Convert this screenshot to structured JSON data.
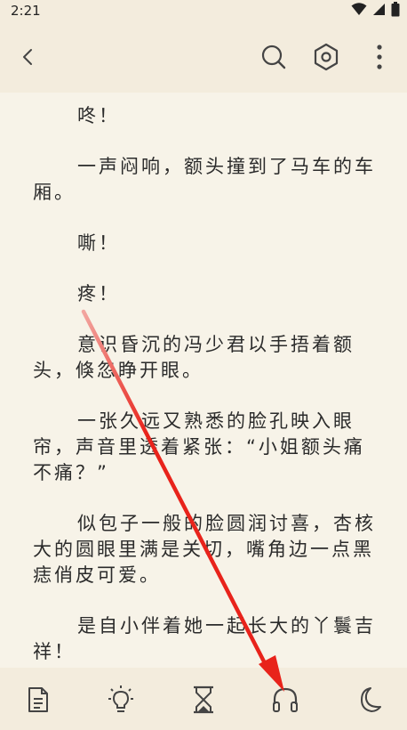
{
  "status_bar": {
    "time": "2:21",
    "icons": [
      "wifi-icon",
      "signal-icon",
      "battery-icon"
    ]
  },
  "top_bar": {
    "icons": [
      "back-icon",
      "search-icon",
      "settings-icon",
      "more-icon"
    ]
  },
  "reader": {
    "paragraphs": [
      "咚！",
      "一声闷响，额头撞到了马车的车厢。",
      "嘶！",
      "疼！",
      "意识昏沉的冯少君以手捂着额头，倏忽睁开眼。",
      "一张久远又熟悉的脸孔映入眼帘，声音里透着紧张：“小姐额头痛不痛？”",
      "似包子一般的脸圆润讨喜，杏核大的圆眼里满是关切，嘴角边一点黑痣俏皮可爱。",
      "是自小伴着她一起长大的丫鬟吉祥！"
    ]
  },
  "bottom_bar": {
    "icons": [
      "catalog-icon",
      "brightness-icon",
      "timer-icon",
      "listen-icon",
      "night-mode-icon"
    ]
  },
  "annotation": {
    "color": "#e8231b"
  }
}
